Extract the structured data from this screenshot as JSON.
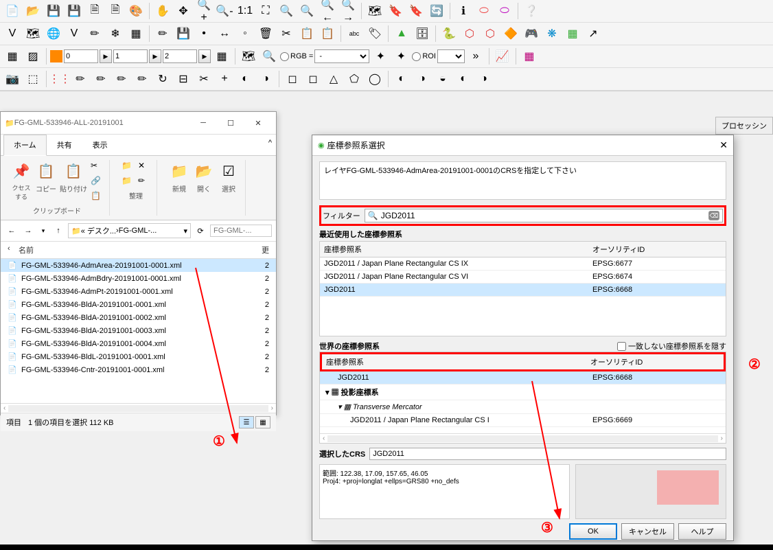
{
  "toolbar_row3": {
    "num1": "0",
    "num2": "1",
    "num3": "2",
    "rgb_label": "RGB =",
    "rgb_value": "-",
    "roi_label": "ROI"
  },
  "processing_label": "プロセッシン",
  "explorer": {
    "title": "FG-GML-533946-ALL-20191001",
    "tabs": [
      "ホーム",
      "共有",
      "表示"
    ],
    "active_tab": 0,
    "ribbon": {
      "access": "クセス\nする",
      "copy": "コピー",
      "paste": "貼り付け",
      "clipboard": "クリップボード",
      "new": "新規",
      "open": "開く",
      "select": "選択",
      "organize": "整理"
    },
    "breadcrumb": [
      "« デスク...",
      "FG-GML-..."
    ],
    "search_placeholder": "FG-GML-...",
    "col_name": "名前",
    "files": [
      "FG-GML-533946-AdmArea-20191001-0001.xml",
      "FG-GML-533946-AdmBdry-20191001-0001.xml",
      "FG-GML-533946-AdmPt-20191001-0001.xml",
      "FG-GML-533946-BldA-20191001-0001.xml",
      "FG-GML-533946-BldA-20191001-0002.xml",
      "FG-GML-533946-BldA-20191001-0003.xml",
      "FG-GML-533946-BldA-20191001-0004.xml",
      "FG-GML-533946-BldL-20191001-0001.xml",
      "FG-GML-533946-Cntr-20191001-0001.xml"
    ],
    "selected_index": 0,
    "status_left": "項目",
    "status": "1 個の項目を選択 112 KB"
  },
  "crs": {
    "title": "座標参照系選択",
    "msg": "レイヤFG-GML-533946-AdmArea-20191001-0001のCRSを指定して下さい",
    "filter_label": "フィルター",
    "filter_value": "JGD2011",
    "recent_label": "最近使用した座標参照系",
    "col_crs": "座標参照系",
    "col_auth": "オーソリティID",
    "recent": [
      {
        "name": "JGD2011 / Japan Plane Rectangular CS IX",
        "auth": "EPSG:6677"
      },
      {
        "name": "JGD2011 / Japan Plane Rectangular CS VI",
        "auth": "EPSG:6674"
      },
      {
        "name": "JGD2011",
        "auth": "EPSG:6668"
      }
    ],
    "recent_selected": 2,
    "world_label": "世界の座標参照系",
    "hide_label": "一致しない座標参照系を隠す",
    "world_header_crs": "座標参照系",
    "world_header_auth": "オーソリティID",
    "world": [
      {
        "indent": 1,
        "name": "JGD2011",
        "auth": "EPSG:6668"
      },
      {
        "indent": 0,
        "name": "投影座標系",
        "auth": "",
        "grp": true
      },
      {
        "indent": 1,
        "name": "Transverse Mercator",
        "auth": "",
        "grp": true,
        "italic": true
      },
      {
        "indent": 2,
        "name": "JGD2011 / Japan Plane Rectangular CS I",
        "auth": "EPSG:6669"
      }
    ],
    "world_selected": 0,
    "selected_crs_label": "選択したCRS",
    "selected_crs": "JGD2011",
    "extent": "範囲: 122.38, 17.09, 157.65, 46.05",
    "proj4": "Proj4: +proj=longlat +ellps=GRS80 +no_defs",
    "ok": "OK",
    "cancel": "キャンセル",
    "help": "ヘルプ"
  },
  "annotations": [
    "①",
    "②",
    "③"
  ]
}
